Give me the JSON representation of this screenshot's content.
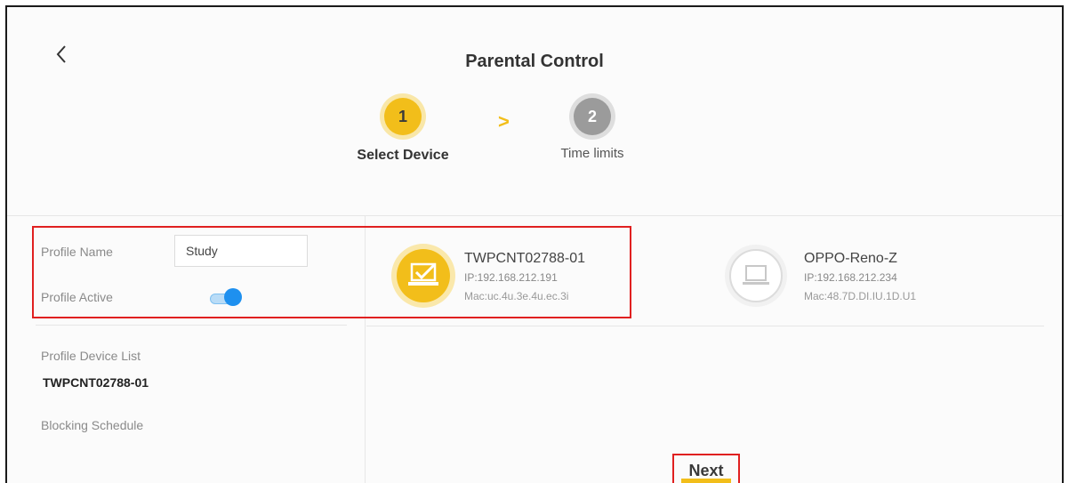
{
  "page": {
    "title": "Parental Control"
  },
  "header": {
    "back_icon": "chevron-left-icon"
  },
  "steps": [
    {
      "number": "1",
      "label": "Select Device",
      "active": true
    },
    {
      "number": "2",
      "label": "Time limits",
      "active": false
    }
  ],
  "step_separator": ">",
  "profile": {
    "name_label": "Profile Name",
    "name_value": "Study",
    "active_label": "Profile Active",
    "active": true,
    "device_list_label": "Profile Device List",
    "device_list_value": "TWPCNT02788-01",
    "blocking_schedule_label": "Blocking Schedule"
  },
  "devices": [
    {
      "name": "TWPCNT02788-01",
      "ip": "IP:192.168.212.191",
      "mac": "Mac:uc.4u.3e.4u.ec.3i",
      "selected": true,
      "icon": "laptop-check-icon"
    },
    {
      "name": "OPPO-Reno-Z",
      "ip": "IP:192.168.212.234",
      "mac": "Mac:48.7D.DI.IU.1D.U1",
      "selected": false,
      "icon": "laptop-icon"
    }
  ],
  "actions": {
    "next_label": "Next"
  },
  "colors": {
    "accent": "#f2be1a",
    "toggle": "#1e90ef",
    "highlight": "#e02020",
    "step_inactive": "#9b9b9b"
  }
}
